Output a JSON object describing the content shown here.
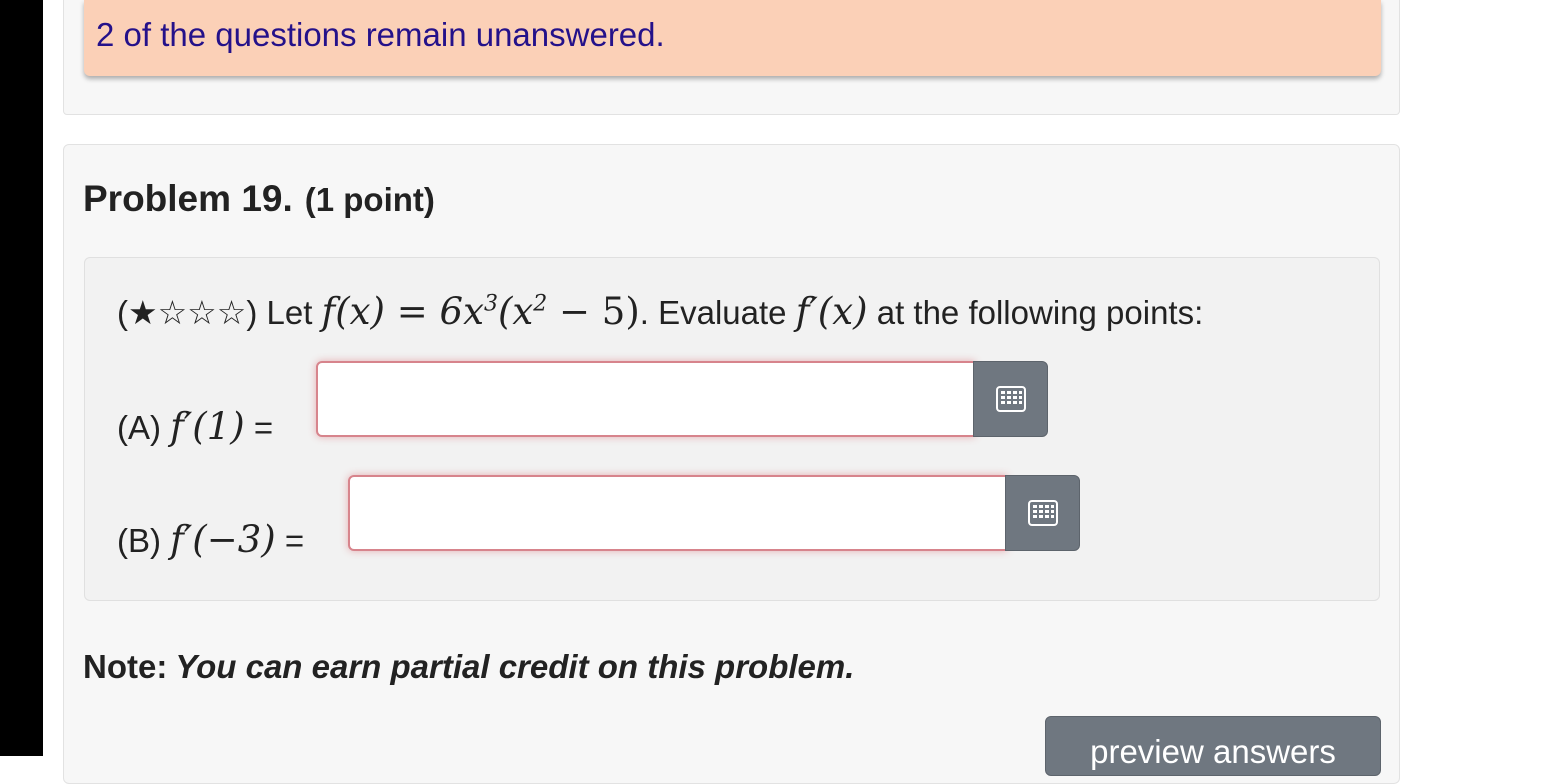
{
  "alert": {
    "message": "2 of the questions remain unanswered."
  },
  "problem": {
    "title": "Problem 19.",
    "points": "(1 point)",
    "difficulty": "(★☆☆☆)",
    "statement_lead": "Let",
    "function_lhs": "f(x)",
    "equals": "=",
    "function_rhs": "6x",
    "exp3": "3",
    "paren_open": "(x",
    "exp2": "2",
    "paren_rest": " − 5)",
    "statement_mid": ". Evaluate",
    "derivative": "f′(x)",
    "statement_end": "at the following points:",
    "parts": [
      {
        "label": "(A)",
        "expression": "f′(1)",
        "equals": "=",
        "value": "",
        "placeholder": ""
      },
      {
        "label": "(B)",
        "expression": "f′(−3)",
        "equals": "=",
        "value": "",
        "placeholder": ""
      }
    ]
  },
  "note": {
    "label": "Note:",
    "text": "You can earn partial credit on this problem."
  },
  "buttons": {
    "preview": "preview answers"
  },
  "icons": {
    "keyboard": "keyboard-icon"
  },
  "colors": {
    "alert_bg": "#fbd0b7",
    "alert_text": "#24118a",
    "input_error_border": "#d7848c",
    "button_gray": "#6f7780"
  }
}
